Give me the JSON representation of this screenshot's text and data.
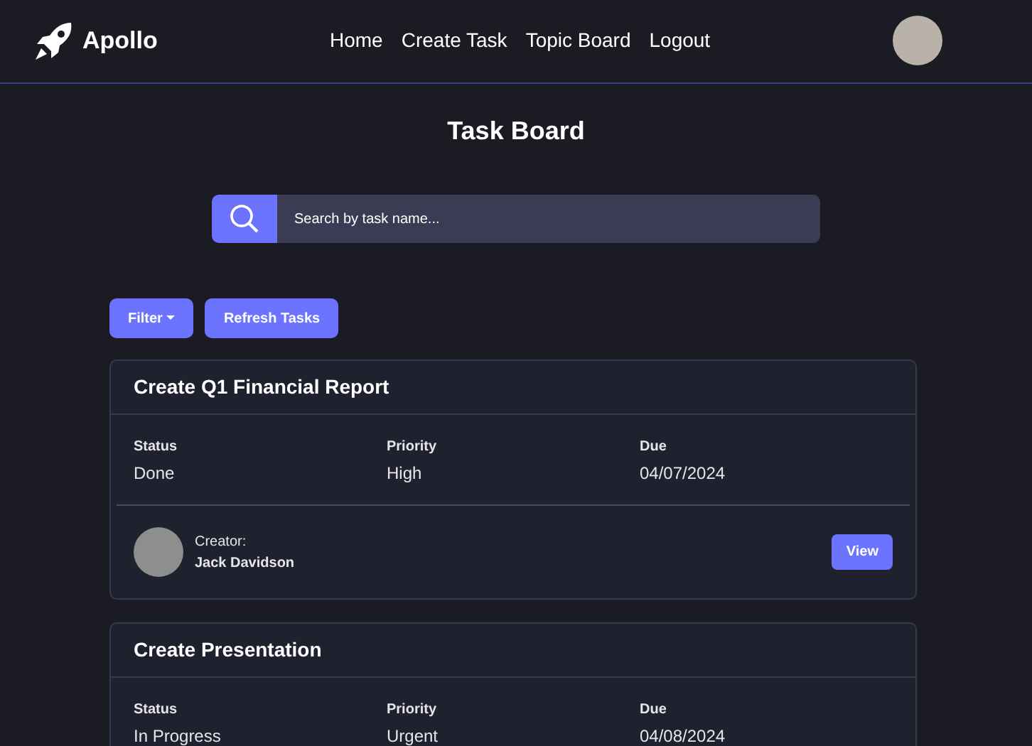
{
  "nav": {
    "brand": "Apollo",
    "links": [
      "Home",
      "Create Task",
      "Topic Board",
      "Logout"
    ]
  },
  "title": "Task Board",
  "search": {
    "placeholder": "Search by task name..."
  },
  "actions": {
    "filter": "Filter",
    "refresh": "Refresh Tasks"
  },
  "tasks": [
    {
      "title": "Create Q1 Financial Report",
      "fields": [
        {
          "label": "Status",
          "value": "Done"
        },
        {
          "label": "Priority",
          "value": "High"
        },
        {
          "label": "Due",
          "value": "04/07/2024"
        }
      ],
      "creator_label": "Creator:",
      "creator": "Jack Davidson",
      "button": "View"
    },
    {
      "title": "Create Presentation",
      "fields": [
        {
          "label": "Status",
          "value": "In Progress"
        },
        {
          "label": "Priority",
          "value": "Urgent"
        },
        {
          "label": "Due",
          "value": "04/08/2024"
        }
      ]
    }
  ]
}
